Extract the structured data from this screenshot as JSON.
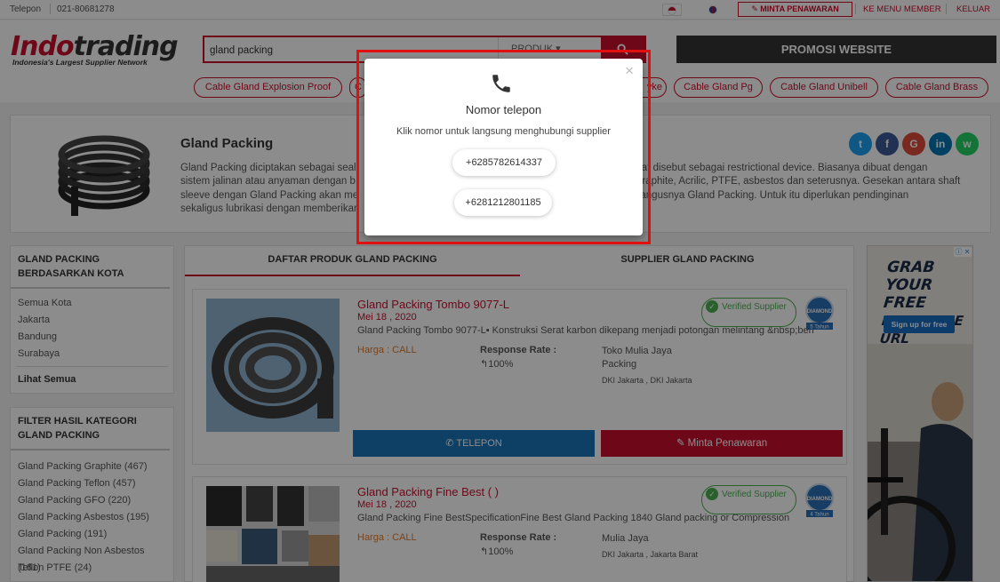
{
  "topbar": {
    "phone_label": "Telepon",
    "phone_number": "021-80681278",
    "minta_penawaran": "MINTA PENAWARAN",
    "member_link": "KE MENU MEMBER",
    "logout_link": "KELUAR"
  },
  "header": {
    "logo_red": "Indo",
    "logo_dark": "trading",
    "logo_tagline": "Indonesia's Largest Supplier Network",
    "search_value": "gland packing",
    "search_category": "PRODUK",
    "promo_button": "PROMOSI WEBSITE",
    "tags": [
      "Cable Gland Explosion Proof",
      "C",
      "yke",
      "Cable Gland Pg",
      "Cable Gland Unibell",
      "Cable Gland Brass"
    ]
  },
  "intro": {
    "title": "Gland Packing",
    "description": "Gland Packing diciptakan sebagai sealing ... sebagai restrictional device. Biasanya dibuat dengan sistem jalinan atau anyaman dengan b... graphite, Acrilic, PTFE, asbestos dan seterusnya. Gesekan antara shaft sleeve dengan Gland Packing akan me... hangusnya Gland Packing. Untuk itu diperlukan pendinginan sekaligus lubrikasi dengan memberikan...",
    "desc_line1_a": "Gland Packing diciptakan sebagai seali",
    "desc_line1_b": "epat disebut sebagai restrictional device. Biasanya dibuat dengan",
    "desc_line2_a": "sistem jalinan atau anyaman dengan b",
    "desc_line2_b": "graphite, Acrilic, PTFE, asbestos dan seterusnya. Gesekan antara shaft",
    "desc_line3_a": "sleeve dengan Gland Packing akan me",
    "desc_line3_b": "hangusnya Gland Packing. Untuk itu diperlukan pendinginan",
    "desc_line4_a": "sekaligus lubrikasi dengan memberikan",
    "social": [
      "t",
      "f",
      "G",
      "in",
      "w"
    ]
  },
  "sidebar": {
    "city_title": "GLAND PACKING BERDASARKAN KOTA",
    "cities": [
      "Semua Kota",
      "Jakarta",
      "Bandung",
      "Surabaya"
    ],
    "see_all": "Lihat Semua",
    "filter_title": "FILTER HASIL KATEGORI GLAND PACKING",
    "filters": [
      "Gland Packing Graphite (467)",
      "Gland Packing Teflon (457)",
      "Gland Packing GFO (220)",
      "Gland Packing Asbestos (195)",
      "Gland Packing (191)",
      "Gland Packing Non Asbestos (161)",
      "Teflon PTFE (24)"
    ]
  },
  "tabs": {
    "products": "DAFTAR PRODUK GLAND PACKING",
    "suppliers": "SUPPLIER GLAND PACKING"
  },
  "products": [
    {
      "title": "Gland Packing Tombo 9077-L",
      "date": "Mei 18 , 2020",
      "description": "Gland Packing Tombo 9077-L▪ Konstruksi Serat karbon dikepang menjadi potongan melintang &nbsp;berr",
      "price": "Harga : CALL",
      "response_label": "Response Rate :",
      "response_value": "100%",
      "supplier": "Toko Mulia Jaya Packing",
      "location": "DKI Jakarta , DKI Jakarta",
      "verified": "Verified Supplier",
      "years": "5 Tahun",
      "btn_call": "TELEPON",
      "btn_quote": "Minta Penawaran"
    },
    {
      "title": "Gland Packing Fine Best ( )",
      "date": "Mei 18 , 2020",
      "description": "Gland Packing Fine BestSpecificationFine Best Gland Packing 1840 Gland packing or Compression",
      "price": "Harga : CALL",
      "response_label": "Response Rate :",
      "response_value": "100%",
      "supplier": "Mulia Jaya",
      "location": "DKI Jakarta , Jakarta Barat",
      "verified": "Verified Supplier",
      "years": "4 Tahun"
    }
  ],
  "ad": {
    "line1": "GRAB",
    "line2": "YOUR FREE",
    "line3": "PAYPAL.ME URL",
    "button": "Sign up for free"
  },
  "modal": {
    "title": "Nomor telepon",
    "description": "Klik nomor untuk langsung menghubungi supplier",
    "phones": [
      "+6285782614337",
      "+6281212801185"
    ],
    "close": "×"
  }
}
